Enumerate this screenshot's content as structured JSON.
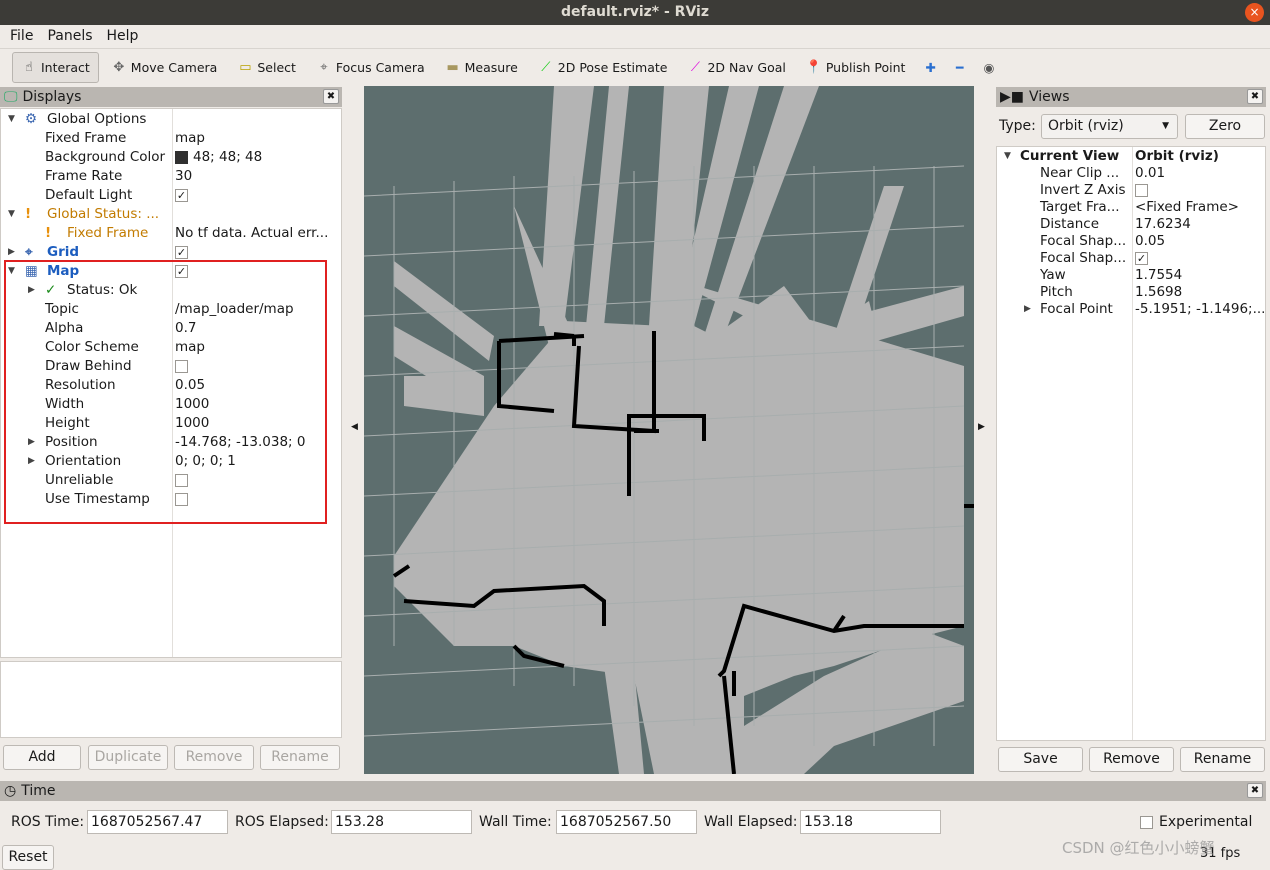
{
  "window": {
    "title": "default.rviz* - RViz",
    "close": "×"
  },
  "menu": [
    "File",
    "Panels",
    "Help"
  ],
  "toolbar": {
    "tools": [
      {
        "label": "Interact",
        "icon": "hand-icon",
        "active": true
      },
      {
        "label": "Move Camera",
        "icon": "move-icon"
      },
      {
        "label": "Select",
        "icon": "select-icon"
      },
      {
        "label": "Focus Camera",
        "icon": "focus-icon"
      },
      {
        "label": "Measure",
        "icon": "ruler-icon"
      },
      {
        "label": "2D Pose Estimate",
        "icon": "green-arrow-icon"
      },
      {
        "label": "2D Nav Goal",
        "icon": "magenta-arrow-icon"
      },
      {
        "label": "Publish Point",
        "icon": "pin-icon"
      }
    ]
  },
  "displays": {
    "title": "Displays",
    "rows": [
      {
        "name": "Global Options",
        "value": "",
        "indent": 1,
        "expand": "down",
        "icon": "⚙"
      },
      {
        "name": "Fixed Frame",
        "value": "map",
        "indent": 2
      },
      {
        "name": "Background Color",
        "value": "48; 48; 48",
        "indent": 2,
        "swatch": "#303030"
      },
      {
        "name": "Frame Rate",
        "value": "30",
        "indent": 2
      },
      {
        "name": "Default Light",
        "value": "✓",
        "indent": 2,
        "check": true
      },
      {
        "name": "Global Status: ...",
        "value": "",
        "indent": 1,
        "expand": "down",
        "warn": true,
        "icon": "!"
      },
      {
        "name": "Fixed Frame",
        "value": "No tf data.  Actual err...",
        "indent": 2,
        "warn": true,
        "icon": "!"
      },
      {
        "name": "Grid",
        "value": "✓",
        "indent": 1,
        "expand": "right",
        "blue": true,
        "check": true,
        "icon": "⌖"
      },
      {
        "name": "Map",
        "value": "✓",
        "indent": 1,
        "expand": "down",
        "blue": true,
        "check": true,
        "icon": "▦"
      },
      {
        "name": "Status: Ok",
        "value": "",
        "indent": 2,
        "expand": "right",
        "icon": "✓"
      },
      {
        "name": "Topic",
        "value": "/map_loader/map",
        "indent": 2
      },
      {
        "name": "Alpha",
        "value": "0.7",
        "indent": 2
      },
      {
        "name": "Color Scheme",
        "value": "map",
        "indent": 2
      },
      {
        "name": "Draw Behind",
        "value": "",
        "indent": 2,
        "check": true
      },
      {
        "name": "Resolution",
        "value": "0.05",
        "indent": 2
      },
      {
        "name": "Width",
        "value": "1000",
        "indent": 2
      },
      {
        "name": "Height",
        "value": "1000",
        "indent": 2
      },
      {
        "name": "Position",
        "value": "-14.768; -13.038; 0",
        "indent": 2,
        "expand": "right"
      },
      {
        "name": "Orientation",
        "value": "0; 0; 0; 1",
        "indent": 2,
        "expand": "right"
      },
      {
        "name": "Unreliable",
        "value": "",
        "indent": 2,
        "check": true
      },
      {
        "name": "Use Timestamp",
        "value": "",
        "indent": 2,
        "check": true
      }
    ],
    "buttons": {
      "add": "Add",
      "duplicate": "Duplicate",
      "remove": "Remove",
      "rename": "Rename"
    }
  },
  "views": {
    "title": "Views",
    "type_label": "Type:",
    "type_value": "Orbit (rviz)",
    "zero": "Zero",
    "rows": [
      {
        "name": "Current View",
        "value": "Orbit (rviz)",
        "bold": true,
        "expand": "down"
      },
      {
        "name": "Near Clip ...",
        "value": "0.01"
      },
      {
        "name": "Invert Z Axis",
        "value": "",
        "check": true
      },
      {
        "name": "Target Fra...",
        "value": "<Fixed Frame>"
      },
      {
        "name": "Distance",
        "value": "17.6234"
      },
      {
        "name": "Focal Shap...",
        "value": "0.05"
      },
      {
        "name": "Focal Shap...",
        "value": "✓",
        "check": true
      },
      {
        "name": "Yaw",
        "value": "1.7554"
      },
      {
        "name": "Pitch",
        "value": "1.5698"
      },
      {
        "name": "Focal Point",
        "value": "-5.1951; -1.1496;...",
        "expand": "right"
      }
    ],
    "buttons": {
      "save": "Save",
      "remove": "Remove",
      "rename": "Rename"
    }
  },
  "time": {
    "title": "Time",
    "ros_time_label": "ROS Time:",
    "ros_time": "1687052567.47",
    "ros_elapsed_label": "ROS Elapsed:",
    "ros_elapsed": "153.28",
    "wall_time_label": "Wall Time:",
    "wall_time": "1687052567.50",
    "wall_elapsed_label": "Wall Elapsed:",
    "wall_elapsed": "153.18",
    "experimental": "Experimental",
    "reset": "Reset",
    "fps": "31 fps"
  },
  "watermark": "CSDN @红色小小螃蟹",
  "colors": {
    "map_unknown": "#5d6e6e",
    "map_free": "#b4b4b4",
    "map_occupied": "#000000",
    "highlight": "#e02020"
  }
}
